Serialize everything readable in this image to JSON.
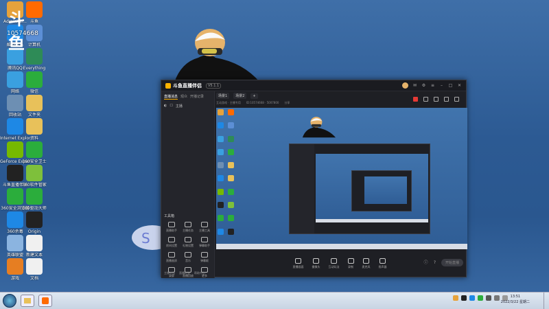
{
  "overlay": {
    "logo_text": "斗鱼",
    "room_id": "10574668"
  },
  "desktop_icons": [
    {
      "label": "Administr...",
      "color": "#e6a23c"
    },
    {
      "label": "斗鱼",
      "color": "#ff6a00"
    },
    {
      "label": "酷狗音乐",
      "color": "#1e88e5"
    },
    {
      "label": "计算机",
      "color": "#5c8fd6"
    },
    {
      "label": "腾讯QQ",
      "color": "#3aa0e0"
    },
    {
      "label": "Everything",
      "color": "#2e8b57"
    },
    {
      "label": "网络",
      "color": "#3aa0e0"
    },
    {
      "label": "微信",
      "color": "#2bad3c"
    },
    {
      "label": "回收站",
      "color": "#6d8fb3"
    },
    {
      "label": "文件夹",
      "color": "#e8c15a"
    },
    {
      "label": "Internet Explorer",
      "color": "#1e88e5"
    },
    {
      "label": "资料",
      "color": "#e8c15a"
    },
    {
      "label": "GeForce Experience",
      "color": "#76b900"
    },
    {
      "label": "360安全卫士",
      "color": "#2bad3c"
    },
    {
      "label": "斗鱼直播伴侣",
      "color": "#222"
    },
    {
      "label": "360软件管家",
      "color": "#7ec03b"
    },
    {
      "label": "360安全浏览器",
      "color": "#2bad3c"
    },
    {
      "label": "360驱动大师",
      "color": "#2bad3c"
    },
    {
      "label": "360杀毒",
      "color": "#1e88e5"
    },
    {
      "label": "Origin",
      "color": "#222"
    },
    {
      "label": "英雄联盟",
      "color": "#8bb4e0"
    },
    {
      "label": "新建文本",
      "color": "#f0f0f0"
    },
    {
      "label": "游戏",
      "color": "#e67e22"
    },
    {
      "label": "文档",
      "color": "#f0f0f0"
    }
  ],
  "app": {
    "brand": "斗鱼直播伴侣",
    "version": "V5.1.1",
    "side_tabs": [
      "直播消息",
      "观众",
      "开播记录"
    ],
    "side_row": [
      "◐",
      "☐",
      "主播"
    ],
    "toolbox_title": "工具箱",
    "tools": [
      {
        "label": "直播助手"
      },
      {
        "label": "主播任务"
      },
      {
        "label": "主播工具"
      },
      {
        "label": "房间设置"
      },
      {
        "label": "礼物设置"
      },
      {
        "label": "弹幕助手"
      },
      {
        "label": "直播画质"
      },
      {
        "label": "音乐"
      },
      {
        "label": "弹幕姬"
      },
      {
        "label": "录屏"
      },
      {
        "label": "直播回放"
      },
      {
        "label": "更多"
      }
    ],
    "side_bottom": [
      "主播公告",
      "直播时长",
      "帮助中心"
    ],
    "scene_tabs": [
      "场景1",
      "场景2",
      "+"
    ],
    "scene_meta": [
      "互动游戏 · 主播专用",
      "ID:10574668 · 5007800",
      "分享"
    ],
    "bottom_tools": [
      {
        "label": "直播画面"
      },
      {
        "label": "摄像头"
      },
      {
        "label": "互动玩法"
      },
      {
        "label": "录制"
      },
      {
        "label": "麦克风"
      },
      {
        "label": "扬声器"
      }
    ],
    "live_button": "开始直播"
  },
  "taskbar": {
    "time": "13:51",
    "date": "2022/3/22 星期二"
  }
}
